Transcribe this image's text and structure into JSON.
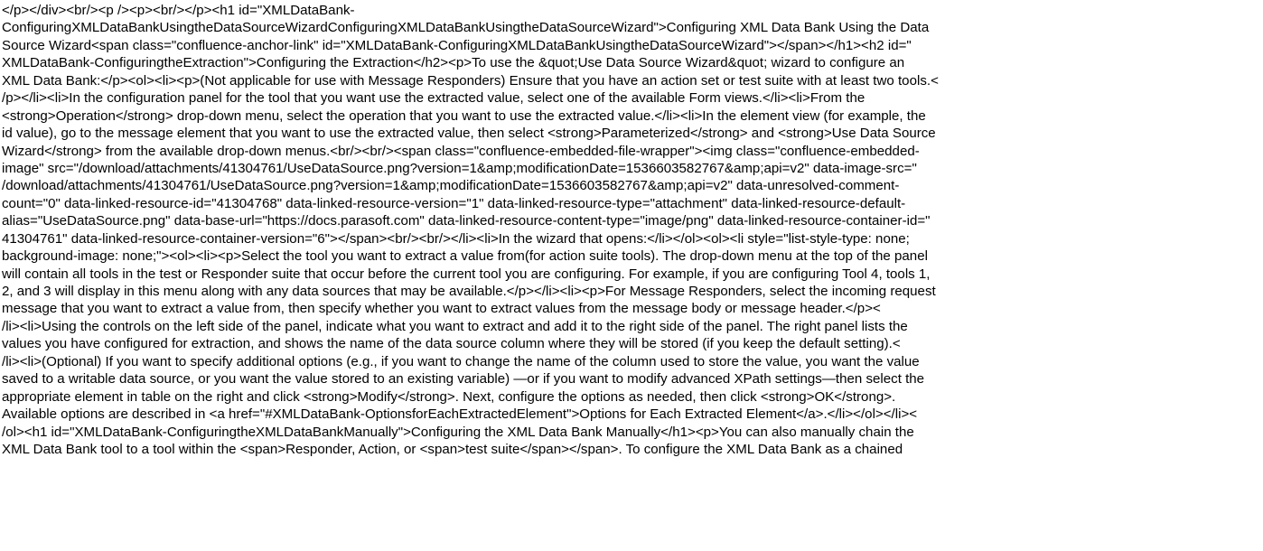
{
  "document": {
    "lines": [
      "</p></div><br/><p /><p><br/></p><h1 id=\"XMLDataBank-",
      "ConfiguringXMLDataBankUsingtheDataSourceWizardConfiguringXMLDataBankUsingtheDataSourceWizard\">Configuring XML Data Bank Using the Data",
      "Source Wizard<span class=\"confluence-anchor-link\" id=\"XMLDataBank-ConfiguringXMLDataBankUsingtheDataSourceWizard\"></span></h1><h2 id=\"",
      "XMLDataBank-ConfiguringtheExtraction\">Configuring the Extraction</h2><p>To use the &quot;Use Data Source Wizard&quot; wizard to configure an",
      "XML Data Bank:</p><ol><li><p>(Not applicable for use with Message Responders) Ensure that you have an action set or test suite with at least two tools.<",
      "/p></li><li>In the configuration panel for the tool that you want use the extracted value, select one of the available Form views.</li><li>From the",
      "<strong>Operation</strong> drop-down menu, select the operation that you want to use the extracted value.</li><li>In the element view (for example, the",
      "id value), go to the message element that you want to use the extracted value, then select <strong>Parameterized</strong> and <strong>Use Data Source",
      "Wizard</strong> from the available drop-down menus.<br/><br/><span class=\"confluence-embedded-file-wrapper\"><img class=\"confluence-embedded-",
      "image\" src=\"/download/attachments/41304761/UseDataSource.png?version=1&amp;modificationDate=1536603582767&amp;api=v2\" data-image-src=\"",
      "/download/attachments/41304761/UseDataSource.png?version=1&amp;modificationDate=1536603582767&amp;api=v2\" data-unresolved-comment-",
      "count=\"0\" data-linked-resource-id=\"41304768\" data-linked-resource-version=\"1\" data-linked-resource-type=\"attachment\" data-linked-resource-default-",
      "alias=\"UseDataSource.png\" data-base-url=\"https://docs.parasoft.com\" data-linked-resource-content-type=\"image/png\" data-linked-resource-container-id=\"",
      "41304761\" data-linked-resource-container-version=\"6\"></span><br/><br/></li><li>In the wizard that opens:</li></ol><ol><li style=\"list-style-type: none;",
      "background-image: none;\"><ol><li><p>Select the tool you want to extract a value from(for action suite tools). The drop-down menu at the top of the panel",
      "will contain all tools in the test or Responder suite that occur before the current tool you are configuring. For example, if you are configuring Tool 4, tools 1,",
      "2, and 3 will display in this menu along with any data sources that may be available.</p></li><li><p>For Message Responders, select the incoming request",
      "message that you want to extract a value from, then specify whether you want to extract values from the message body or message header.</p><",
      "/li><li>Using the controls on the left side of the panel, indicate what you want to extract and add it to the right side of the panel. The right panel lists the",
      "values you have configured for extraction, and shows the name of the data source column where they will be stored (if you keep the default setting).<",
      "/li><li>(Optional) If you want to specify additional options (e.g., if you want to change the name of the column used to store the value, you want the value",
      "saved to a writable data source, or you want the value stored to an existing variable) —or if you want to modify advanced XPath settings—then select the",
      "appropriate element in table on the right and click <strong>Modify</strong>. Next, configure the options as needed, then click <strong>OK</strong>.",
      "Available options are described in <a href=\"#XMLDataBank-OptionsforEachExtractedElement\">Options for Each Extracted Element</a>.</li></ol></li><",
      "/ol><h1 id=\"XMLDataBank-ConfiguringtheXMLDataBankManually\">Configuring the XML Data Bank Manually</h1><p>You can also manually chain the",
      "XML Data Bank tool to a tool within the <span>Responder, Action, or <span>test suite</span></span>. To configure the XML Data Bank as a chained"
    ]
  }
}
